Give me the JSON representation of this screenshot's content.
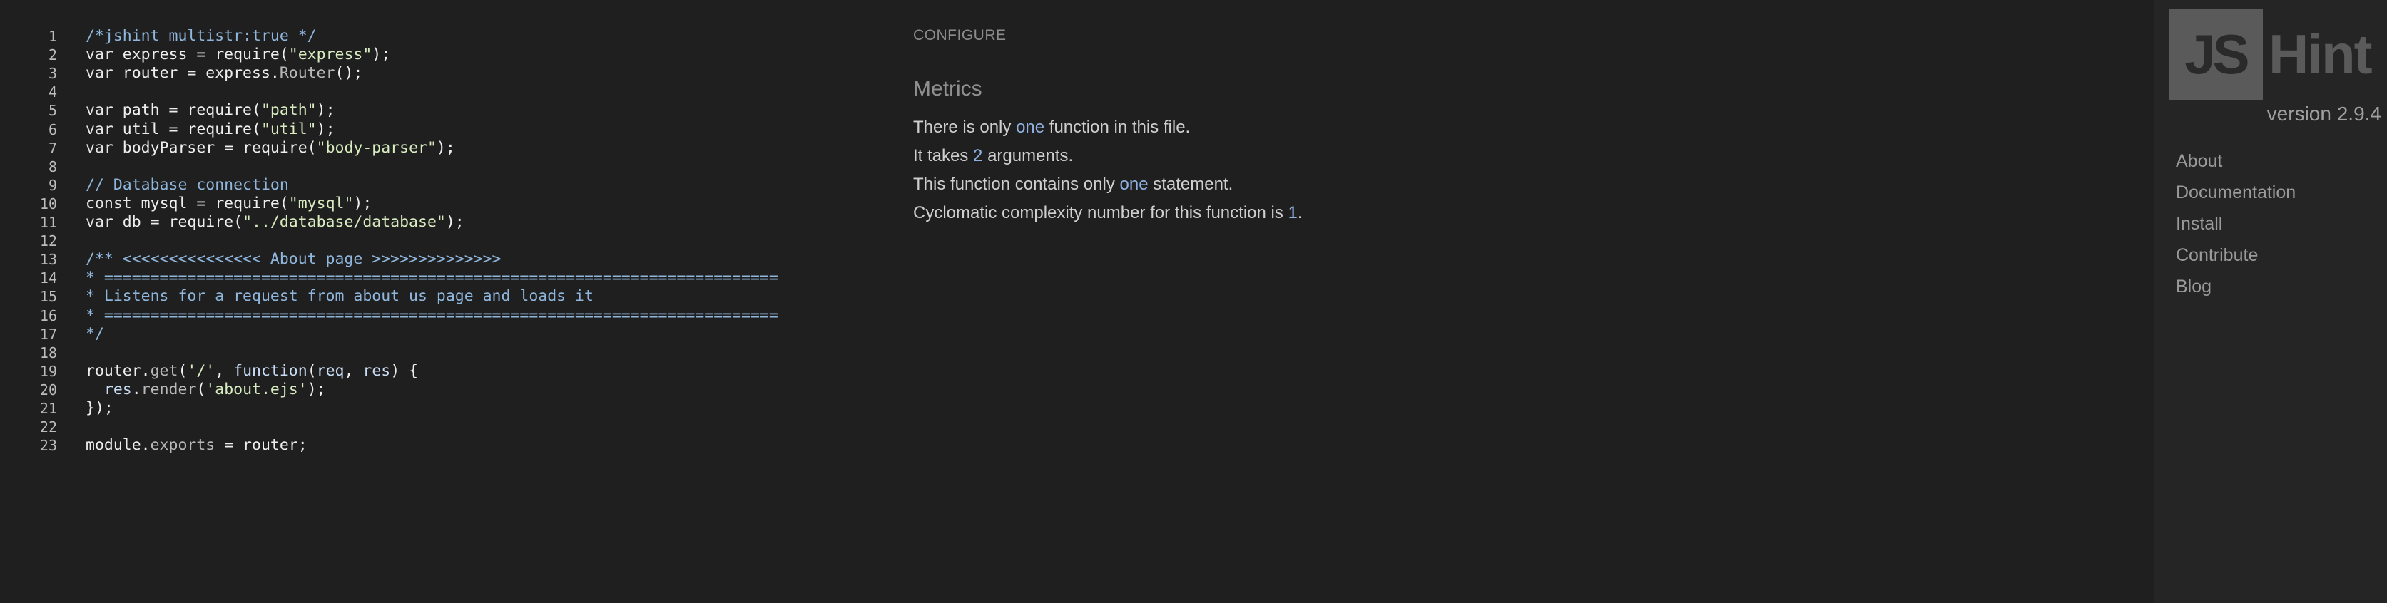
{
  "editor": {
    "lines": [
      {
        "n": "1",
        "segs": [
          [
            "cm",
            "/*jshint multistr:true */"
          ]
        ]
      },
      {
        "n": "2",
        "segs": [
          [
            "kw",
            "var"
          ],
          [
            "",
            " express = require("
          ],
          [
            "str",
            "\"express\""
          ],
          [
            "",
            ");"
          ]
        ]
      },
      {
        "n": "3",
        "segs": [
          [
            "kw",
            "var"
          ],
          [
            "",
            " router = express."
          ],
          [
            "mem",
            "Router"
          ],
          [
            "",
            "();"
          ]
        ]
      },
      {
        "n": "4",
        "segs": []
      },
      {
        "n": "5",
        "segs": [
          [
            "kw",
            "var"
          ],
          [
            "",
            " path = require("
          ],
          [
            "str",
            "\"path\""
          ],
          [
            "",
            ");"
          ]
        ]
      },
      {
        "n": "6",
        "segs": [
          [
            "kw",
            "var"
          ],
          [
            "",
            " util = require("
          ],
          [
            "str",
            "\"util\""
          ],
          [
            "",
            ");"
          ]
        ]
      },
      {
        "n": "7",
        "segs": [
          [
            "kw",
            "var"
          ],
          [
            "",
            " bodyParser = require("
          ],
          [
            "str",
            "\"body-parser\""
          ],
          [
            "",
            ");"
          ]
        ]
      },
      {
        "n": "8",
        "segs": []
      },
      {
        "n": "9",
        "segs": [
          [
            "cm",
            "// Database connection"
          ]
        ]
      },
      {
        "n": "10",
        "segs": [
          [
            "kw",
            "const"
          ],
          [
            "",
            " mysql = require("
          ],
          [
            "str",
            "\"mysql\""
          ],
          [
            "",
            ");"
          ]
        ]
      },
      {
        "n": "11",
        "segs": [
          [
            "kw",
            "var"
          ],
          [
            "",
            " db = require("
          ],
          [
            "str",
            "\"../database/database\""
          ],
          [
            "",
            ");"
          ]
        ]
      },
      {
        "n": "12",
        "segs": []
      },
      {
        "n": "13",
        "segs": [
          [
            "cm",
            "/** <<<<<<<<<<<<<<< About page >>>>>>>>>>>>>>"
          ]
        ]
      },
      {
        "n": "14",
        "segs": [
          [
            "cm",
            "* ========================================================================="
          ]
        ]
      },
      {
        "n": "15",
        "segs": [
          [
            "cm",
            "* Listens for a request from about us page and loads it"
          ]
        ]
      },
      {
        "n": "16",
        "segs": [
          [
            "cm",
            "* ========================================================================="
          ]
        ]
      },
      {
        "n": "17",
        "segs": [
          [
            "cm",
            "*/"
          ]
        ]
      },
      {
        "n": "18",
        "segs": []
      },
      {
        "n": "19",
        "segs": [
          [
            "",
            "router."
          ],
          [
            "mem",
            "get"
          ],
          [
            "",
            "("
          ],
          [
            "str",
            "'/'"
          ],
          [
            "",
            ", "
          ],
          [
            "fn",
            "function"
          ],
          [
            "",
            "("
          ],
          [
            "fn",
            "req"
          ],
          [
            "",
            ", "
          ],
          [
            "fn",
            "res"
          ],
          [
            "",
            ") {"
          ]
        ]
      },
      {
        "n": "20",
        "segs": [
          [
            "",
            "  "
          ],
          [
            "fn",
            "res"
          ],
          [
            "",
            "."
          ],
          [
            "mem",
            "render"
          ],
          [
            "",
            "("
          ],
          [
            "str",
            "'about.ejs'"
          ],
          [
            "",
            ");"
          ]
        ]
      },
      {
        "n": "21",
        "segs": [
          [
            "",
            "});"
          ]
        ]
      },
      {
        "n": "22",
        "segs": []
      },
      {
        "n": "23",
        "segs": [
          [
            "",
            "module."
          ],
          [
            "mem",
            "exports"
          ],
          [
            "",
            ""
          ],
          [
            "",
            " = router;"
          ]
        ]
      }
    ]
  },
  "report": {
    "configure_label": "CONFIGURE",
    "metrics_title": "Metrics",
    "metrics": [
      {
        "pre": "There is only ",
        "hl": "one",
        "post": " function in this file."
      },
      {
        "pre": "It takes ",
        "hl": "2",
        "post": " arguments."
      },
      {
        "pre": "This function contains only ",
        "hl": "one",
        "post": " statement."
      },
      {
        "pre": "Cyclomatic complexity number for this function is ",
        "hl": "1",
        "post": "."
      }
    ]
  },
  "sidebar": {
    "logo_js": "JS",
    "logo_hint": "Hint",
    "version": "version 2.9.4",
    "nav": [
      "About",
      "Documentation",
      "Install",
      "Contribute",
      "Blog"
    ]
  },
  "colors": {
    "background": "#1f1f1f",
    "sidebar": "#252525",
    "comment": "#8fb6dc",
    "string": "#d8ecc0",
    "highlight": "#8fb0e0",
    "logo": "#5a5a5a"
  }
}
